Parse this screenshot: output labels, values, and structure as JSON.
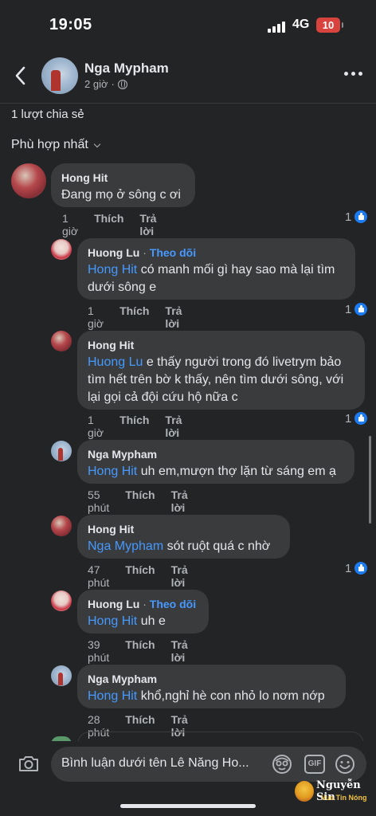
{
  "status_bar": {
    "time": "19:05",
    "network": "4G",
    "battery": "10"
  },
  "header": {
    "author": "Nga Mypham",
    "time": "2 giờ",
    "separator": "·"
  },
  "shares": "1 lượt chia sẻ",
  "sort": {
    "label": "Phù hợp nhất"
  },
  "actions": {
    "like": "Thích",
    "reply": "Trả lời"
  },
  "comments": [
    {
      "name": "Hong Hit",
      "follow": "",
      "mention": "",
      "text": "Đang mọ ở sông c ơi",
      "time": "1 giờ",
      "reactions": "1"
    },
    {
      "name": "Huong Lu",
      "follow": "Theo dõi",
      "mention": "Hong Hit",
      "text": " có manh mối gì hay sao mà lại tìm dưới sông e",
      "time": "1 giờ",
      "reactions": "1"
    },
    {
      "name": "Hong Hit",
      "follow": "",
      "mention": "Huong Lu",
      "text": " e thấy người trong đó livetrym bảo tìm hết trên bờ k thấy, nên tìm dưới sông, với lại gọi cả đội cứu hộ nữa c",
      "time": "1 giờ",
      "reactions": "1"
    },
    {
      "name": "Nga Mypham",
      "follow": "",
      "mention": "Hong Hit",
      "text": " uh em,mượn thợ lặn từ sáng em ạ",
      "time": "55 phút",
      "reactions": ""
    },
    {
      "name": "Hong Hit",
      "follow": "",
      "mention": "Nga Mypham",
      "text": " sót ruột quá c nhờ",
      "time": "47 phút",
      "reactions": "1"
    },
    {
      "name": "Huong Lu",
      "follow": "Theo dõi",
      "mention": "Hong Hit",
      "text": " uh e",
      "time": "39 phút",
      "reactions": ""
    },
    {
      "name": "Nga Mypham",
      "follow": "",
      "mention": "Hong Hit",
      "text": " khổ,nghỉ hè con nhỏ lo nơm nớp",
      "time": "28 phút",
      "reactions": ""
    }
  ],
  "composer": {
    "placeholder": "Bình luận dưới tên Lê Năng Ho...",
    "gif": "GIF"
  },
  "watermark": {
    "name": "Nguyễn Sin",
    "tagline": "Vua Tin Nóng"
  },
  "colors": {
    "background": "#232426",
    "bubble": "#3a3b3c",
    "link": "#4599ff",
    "like": "#1d7bf0"
  },
  "icons": [
    "back-icon",
    "globe-icon",
    "more-icon",
    "chevron-down-icon",
    "like-icon",
    "camera-icon",
    "avatar-sticker-icon",
    "gif-icon",
    "emoji-icon"
  ]
}
